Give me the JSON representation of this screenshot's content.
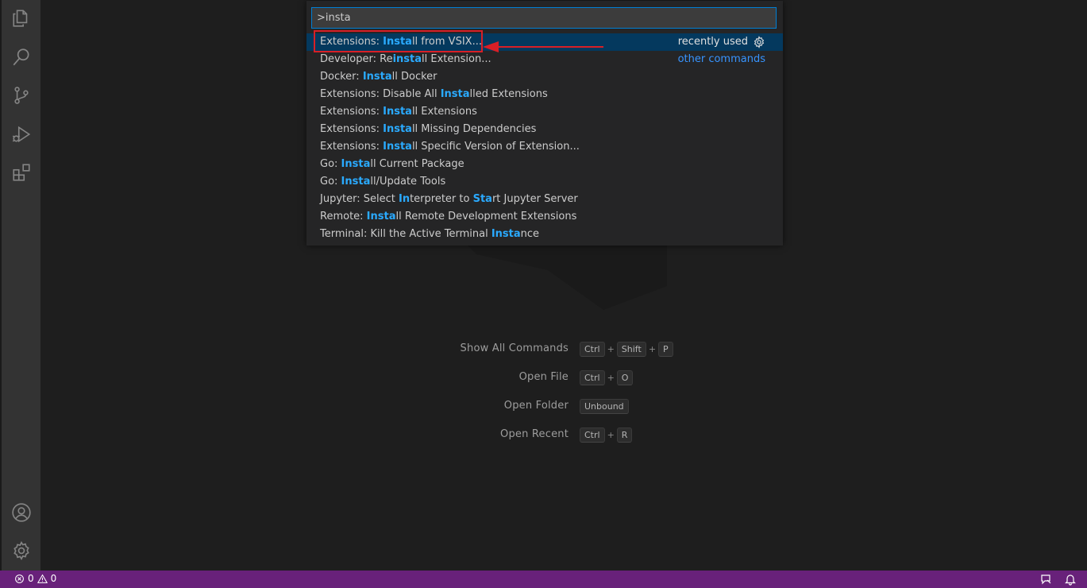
{
  "activity_bar": {
    "icons": [
      "explorer-icon",
      "search-icon",
      "source-control-icon",
      "run-debug-icon",
      "extensions-icon",
      "account-icon",
      "manage-gear-icon"
    ]
  },
  "quick_input": {
    "value": ">insta",
    "items": [
      {
        "segments": [
          [
            "Extensions: ",
            false
          ],
          [
            "Insta",
            true
          ],
          [
            "ll from VSIX...",
            false
          ]
        ],
        "meta": "recently used",
        "selected": true
      },
      {
        "segments": [
          [
            "Developer: Re",
            false
          ],
          [
            "insta",
            true
          ],
          [
            "ll Extension...",
            false
          ]
        ],
        "meta": "other commands"
      },
      {
        "segments": [
          [
            "Docker: ",
            false
          ],
          [
            "Insta",
            true
          ],
          [
            "ll Docker",
            false
          ]
        ]
      },
      {
        "segments": [
          [
            "Extensions: Disable All ",
            false
          ],
          [
            "Insta",
            true
          ],
          [
            "lled Extensions",
            false
          ]
        ]
      },
      {
        "segments": [
          [
            "Extensions: ",
            false
          ],
          [
            "Insta",
            true
          ],
          [
            "ll Extensions",
            false
          ]
        ]
      },
      {
        "segments": [
          [
            "Extensions: ",
            false
          ],
          [
            "Insta",
            true
          ],
          [
            "ll Missing Dependencies",
            false
          ]
        ]
      },
      {
        "segments": [
          [
            "Extensions: ",
            false
          ],
          [
            "Insta",
            true
          ],
          [
            "ll Specific Version of Extension...",
            false
          ]
        ]
      },
      {
        "segments": [
          [
            "Go: ",
            false
          ],
          [
            "Insta",
            true
          ],
          [
            "ll Current Package",
            false
          ]
        ]
      },
      {
        "segments": [
          [
            "Go: ",
            false
          ],
          [
            "Insta",
            true
          ],
          [
            "ll/Update Tools",
            false
          ]
        ]
      },
      {
        "segments": [
          [
            "Jupyter: Select ",
            false
          ],
          [
            "In",
            true
          ],
          [
            "terpreter to ",
            false
          ],
          [
            "Sta",
            true
          ],
          [
            "rt Jupyter Server",
            false
          ]
        ]
      },
      {
        "segments": [
          [
            "Remote: ",
            false
          ],
          [
            "Insta",
            true
          ],
          [
            "ll Remote Development Extensions",
            false
          ]
        ]
      },
      {
        "segments": [
          [
            "Terminal: Kill the Active Terminal ",
            false
          ],
          [
            "Insta",
            true
          ],
          [
            "nce",
            false
          ]
        ]
      }
    ]
  },
  "welcome": {
    "shortcuts": [
      {
        "label": "Show All Commands",
        "keys": [
          "Ctrl",
          "Shift",
          "P"
        ]
      },
      {
        "label": "Open File",
        "keys": [
          "Ctrl",
          "O"
        ]
      },
      {
        "label": "Open Folder",
        "keys": [
          "Unbound"
        ]
      },
      {
        "label": "Open Recent",
        "keys": [
          "Ctrl",
          "R"
        ]
      }
    ]
  },
  "status_bar": {
    "errors": "0",
    "warnings": "0"
  },
  "colors": {
    "status_bar": "#68217a",
    "selection": "#04395e",
    "highlight": "#2aaaff",
    "annotation": "#d81f26"
  }
}
